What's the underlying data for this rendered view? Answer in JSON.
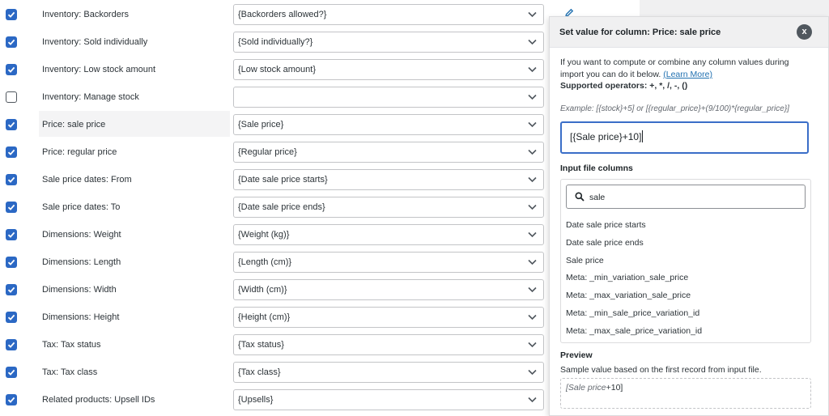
{
  "rows": [
    {
      "label": "Inventory: Backorders",
      "checked": true,
      "value": "{Backorders allowed?}"
    },
    {
      "label": "Inventory: Sold individually",
      "checked": true,
      "value": "{Sold individually?}"
    },
    {
      "label": "Inventory: Low stock amount",
      "checked": true,
      "value": "{Low stock amount}"
    },
    {
      "label": "Inventory: Manage stock",
      "checked": false,
      "value": ""
    },
    {
      "label": "Price: sale price",
      "checked": true,
      "value": "{Sale price}",
      "highlighted": true
    },
    {
      "label": "Price: regular price",
      "checked": true,
      "value": "{Regular price}"
    },
    {
      "label": "Sale price dates: From",
      "checked": true,
      "value": "{Date sale price starts}"
    },
    {
      "label": "Sale price dates: To",
      "checked": true,
      "value": "{Date sale price ends}"
    },
    {
      "label": "Dimensions: Weight",
      "checked": true,
      "value": "{Weight (kg)}"
    },
    {
      "label": "Dimensions: Length",
      "checked": true,
      "value": "{Length (cm)}"
    },
    {
      "label": "Dimensions: Width",
      "checked": true,
      "value": "{Width (cm)}"
    },
    {
      "label": "Dimensions: Height",
      "checked": true,
      "value": "{Height (cm)}"
    },
    {
      "label": "Tax: Tax status",
      "checked": true,
      "value": "{Tax status}"
    },
    {
      "label": "Tax: Tax class",
      "checked": true,
      "value": "{Tax class}"
    },
    {
      "label": "Related products: Upsell IDs",
      "checked": true,
      "value": "{Upsells}"
    }
  ],
  "panel": {
    "title": "Set value for column: Price: sale price",
    "close_label": "x",
    "description": "If you want to compute or combine any column values during import you can do it below.",
    "learn_more": "(Learn More)",
    "operators": "Supported operators: +, *, /, -, ()",
    "example": "Example: [{stock}+5] or [{regular_price}+(9/100)*{regular_price}]",
    "formula_value": "[{Sale price}+10]",
    "input_columns_title": "Input file columns",
    "search_value": "sale",
    "columns": [
      "Date sale price starts",
      "Date sale price ends",
      "Sale price",
      "Meta: _min_variation_sale_price",
      "Meta: _max_variation_sale_price",
      "Meta: _min_sale_price_variation_id",
      "Meta: _max_sale_price_variation_id"
    ],
    "preview_title": "Preview",
    "preview_desc": "Sample value based on the first record from input file.",
    "preview_value_italic": "[Sale price",
    "preview_value_rest": "+10]"
  },
  "colors": {
    "accent": "#2b68c4",
    "focus": "#3a6ec8",
    "link": "#2271b1"
  }
}
